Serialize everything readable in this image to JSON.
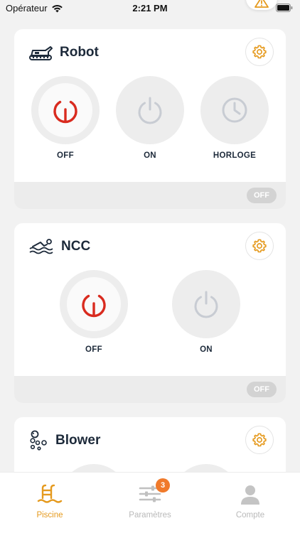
{
  "status_bar": {
    "carrier": "Opérateur",
    "time": "2:21 PM"
  },
  "colors": {
    "accent": "#e59a1e",
    "power_off_red": "#d92b1f",
    "inactive_icon": "#c8ccd3",
    "badge": "#f07a2b"
  },
  "cards": {
    "robot": {
      "title": "Robot",
      "icon": "robot-icon",
      "modes": [
        {
          "label": "OFF",
          "icon": "power-icon",
          "active": true
        },
        {
          "label": "ON",
          "icon": "power-icon",
          "active": false
        },
        {
          "label": "HORLOGE",
          "icon": "clock-icon",
          "active": false
        }
      ],
      "state": "OFF"
    },
    "ncc": {
      "title": "NCC",
      "icon": "swimmer-icon",
      "modes": [
        {
          "label": "OFF",
          "icon": "power-icon",
          "active": true
        },
        {
          "label": "ON",
          "icon": "power-icon",
          "active": false
        }
      ],
      "state": "OFF"
    },
    "blower": {
      "title": "Blower",
      "icon": "bubbles-icon"
    }
  },
  "tab_bar": {
    "tabs": [
      {
        "label": "Piscine",
        "icon": "pool-ladder-icon",
        "active": true
      },
      {
        "label": "Paramètres",
        "icon": "sliders-icon",
        "active": false,
        "badge": "3"
      },
      {
        "label": "Compte",
        "icon": "user-icon",
        "active": false
      }
    ]
  }
}
